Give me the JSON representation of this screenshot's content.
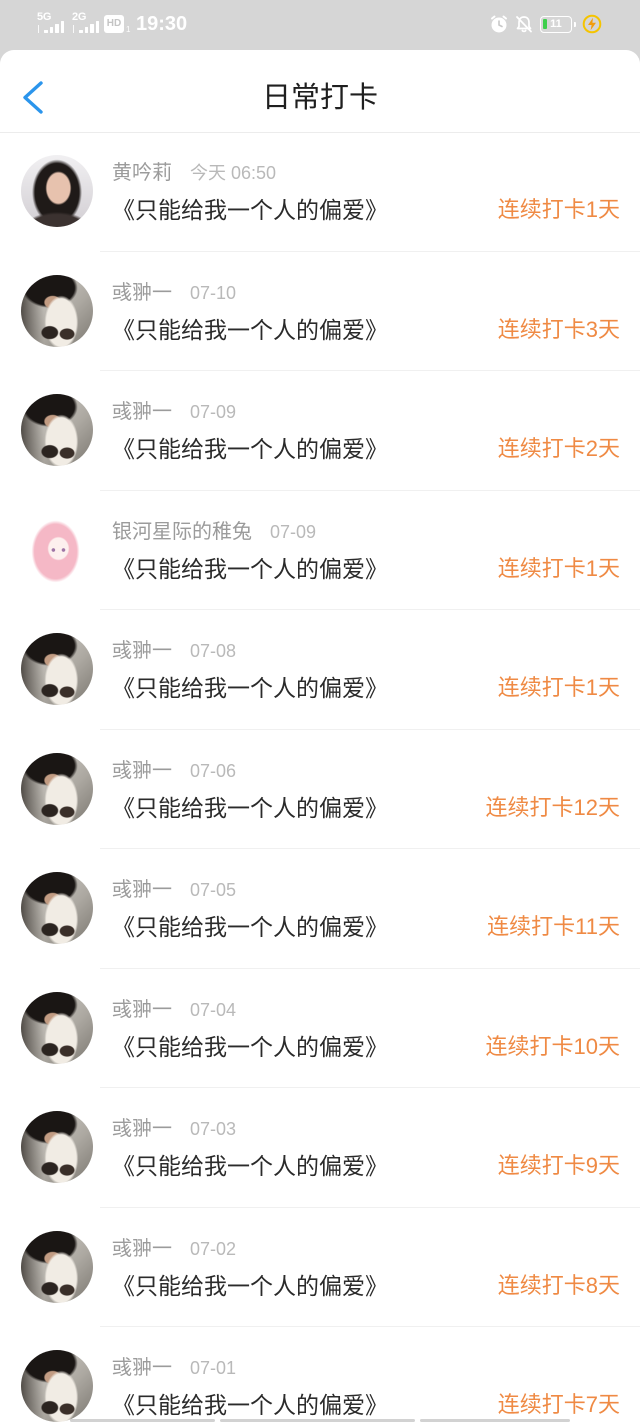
{
  "status_bar": {
    "sim1_network": "5G",
    "sim2_network": "2G",
    "hd_badge": "HD",
    "hd_sim": "1",
    "time": "19:30",
    "battery_level": "11"
  },
  "icons": {
    "back": "chevron-left-icon",
    "alarm": "alarm-icon",
    "bell_off": "bell-off-icon",
    "charging": "charging-icon"
  },
  "colors": {
    "accent": "#2b95ec",
    "streak": "#ef8a44",
    "name": "#9b9b9b",
    "time": "#b9b9b9",
    "title": "#2b2b2b",
    "statusbar": "#d6d6d6",
    "divider": "#f0f0f0"
  },
  "header": {
    "title": "日常打卡"
  },
  "entries": [
    {
      "name": "黄吟莉",
      "time": "今天 06:50",
      "title": "《只能给我一个人的偏爱》",
      "streak": "连续打卡1天"
    },
    {
      "name": "彧翀一",
      "time": "07-10",
      "title": "《只能给我一个人的偏爱》",
      "streak": "连续打卡3天"
    },
    {
      "name": "彧翀一",
      "time": "07-09",
      "title": "《只能给我一个人的偏爱》",
      "streak": "连续打卡2天"
    },
    {
      "name": "银河星际的稚兔",
      "time": "07-09",
      "title": "《只能给我一个人的偏爱》",
      "streak": "连续打卡1天"
    },
    {
      "name": "彧翀一",
      "time": "07-08",
      "title": "《只能给我一个人的偏爱》",
      "streak": "连续打卡1天"
    },
    {
      "name": "彧翀一",
      "time": "07-06",
      "title": "《只能给我一个人的偏爱》",
      "streak": "连续打卡12天"
    },
    {
      "name": "彧翀一",
      "time": "07-05",
      "title": "《只能给我一个人的偏爱》",
      "streak": "连续打卡11天"
    },
    {
      "name": "彧翀一",
      "time": "07-04",
      "title": "《只能给我一个人的偏爱》",
      "streak": "连续打卡10天"
    },
    {
      "name": "彧翀一",
      "time": "07-03",
      "title": "《只能给我一个人的偏爱》",
      "streak": "连续打卡9天"
    },
    {
      "name": "彧翀一",
      "time": "07-02",
      "title": "《只能给我一个人的偏爱》",
      "streak": "连续打卡8天"
    },
    {
      "name": "彧翀一",
      "time": "07-01",
      "title": "《只能给我一个人的偏爱》",
      "streak": "连续打卡7天"
    }
  ]
}
